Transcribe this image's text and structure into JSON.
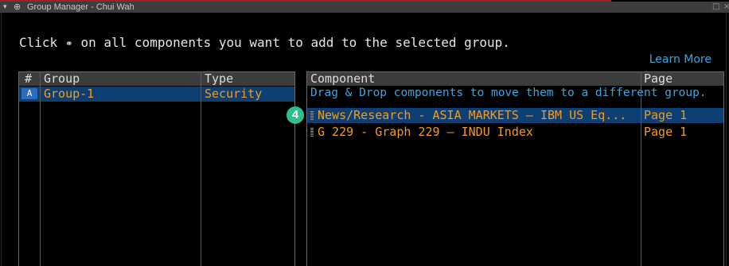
{
  "window": {
    "title": "Group Manager - Chui Wah",
    "chevron": "▾",
    "move_glyph": "⊕",
    "maximize_glyph": "□",
    "close_glyph": "×"
  },
  "instruction": {
    "before": "Click ",
    "icon": "⚭",
    "after": " on all components you want to add to the selected group."
  },
  "learn_more": "Learn More",
  "groups_table": {
    "headers": {
      "num": "#",
      "group": "Group",
      "type": "Type"
    },
    "rows": [
      {
        "letter": "A",
        "group": "Group-1",
        "type": "Security",
        "selected": true
      }
    ]
  },
  "components_table": {
    "headers": {
      "component": "Component",
      "page": "Page"
    },
    "hint": "Drag & Drop components to move them to a different group.",
    "rows": [
      {
        "component": "News/Research - ASIA MARKETS – IBM US Eq...",
        "page": "Page 1",
        "selected": true
      },
      {
        "component": "G 229 - Graph 229 – INDU Index",
        "page": "Page 1",
        "selected": false
      }
    ]
  },
  "step_badge": "4",
  "colors": {
    "accent_orange": "#f39c1c",
    "link_blue": "#35a8e3",
    "selection_blue": "#0d3f75",
    "step_green": "#2fbf8a",
    "title_red": "#b5171b"
  }
}
